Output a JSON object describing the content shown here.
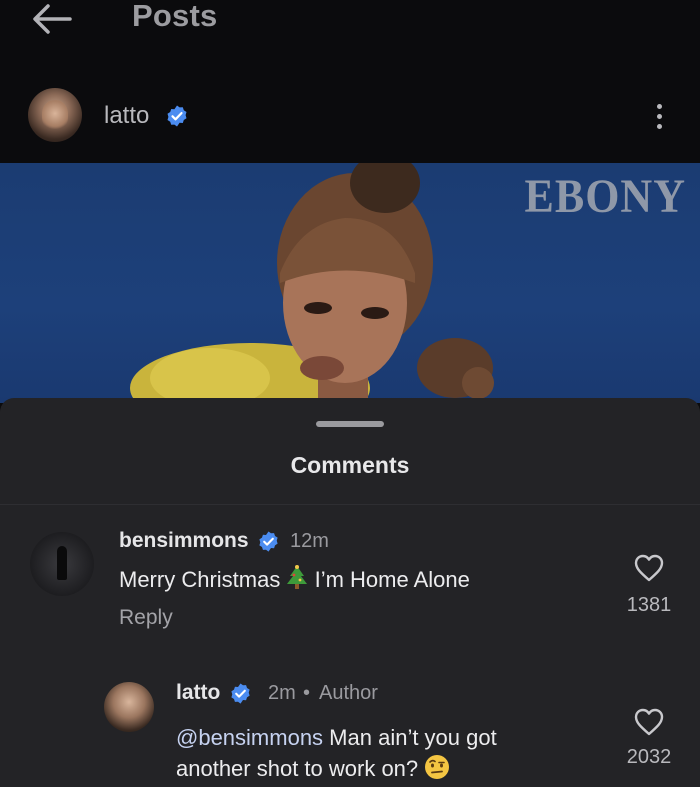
{
  "topbar": {
    "title": "Posts",
    "back_icon": "arrow-left-icon"
  },
  "post": {
    "author": "latto",
    "brand_text": "EBONY",
    "more_icon": "more-vertical-icon"
  },
  "comments_sheet": {
    "title": "Comments",
    "items": [
      {
        "username": "bensimmons",
        "verified": true,
        "time": "12m",
        "text_before": "Merry Christmas",
        "emoji": "christmas-tree",
        "text_after": " I’m Home Alone",
        "reply_label": "Reply",
        "likes": "1381"
      },
      {
        "username": "latto",
        "verified": true,
        "time": "2m",
        "separator": "•",
        "badge": "Author",
        "mention": "@bensimmons",
        "text_line1": " Man ain’t you got",
        "text_line2": "another shot to work on?",
        "emoji": "face-with-raised-eyebrow",
        "likes": "2032"
      }
    ]
  },
  "colors": {
    "background": "#0b0b0d",
    "sheet": "#232326",
    "verified": "#4b8cf0",
    "post_bg": "#1d407a"
  }
}
